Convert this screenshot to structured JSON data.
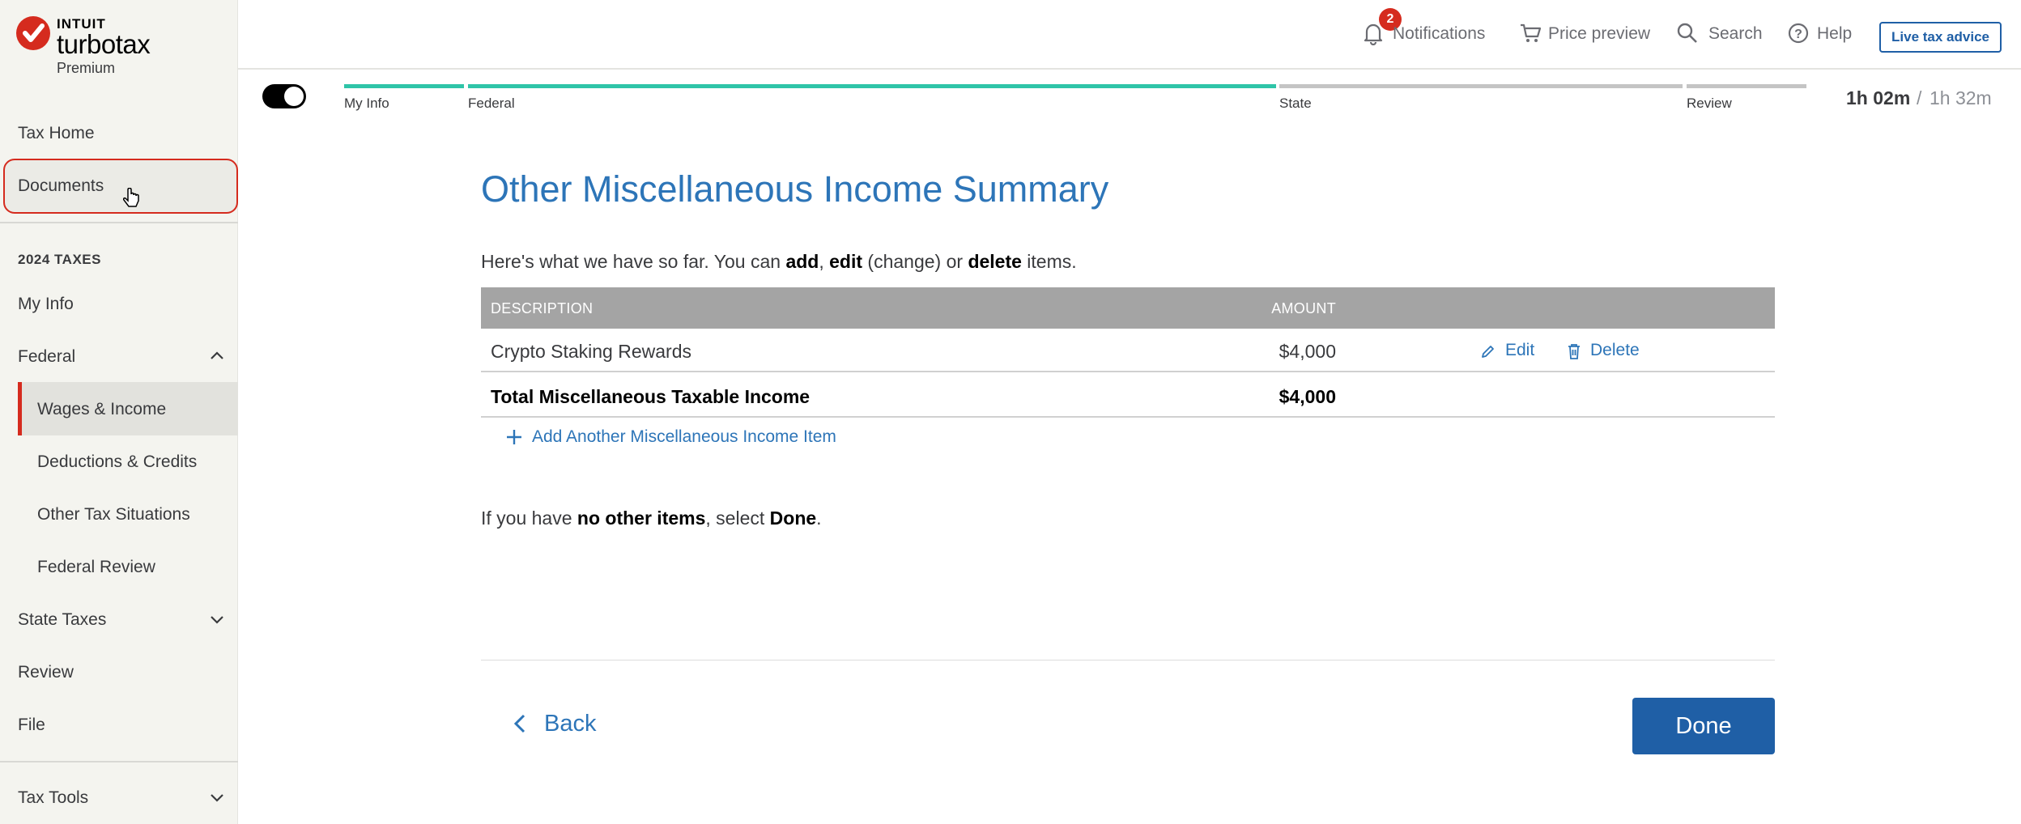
{
  "brand": {
    "company": "INTUIT",
    "product": "turbotax",
    "edition": "Premium"
  },
  "sidebar": {
    "tax_home": "Tax Home",
    "documents": "Documents",
    "section_label": "2024 TAXES",
    "my_info": "My Info",
    "federal": "Federal",
    "federal_sub": [
      "Wages & Income",
      "Deductions & Credits",
      "Other Tax Situations",
      "Federal Review"
    ],
    "state_taxes": "State Taxes",
    "review": "Review",
    "file": "File",
    "tax_tools": "Tax Tools"
  },
  "topbar": {
    "notifications": "Notifications",
    "notification_count": "2",
    "price_preview": "Price preview",
    "search": "Search",
    "help": "Help",
    "live_advice": "Live tax advice"
  },
  "progress": {
    "steps": [
      "My Info",
      "Federal",
      "State",
      "Review"
    ],
    "completed_steps": 2,
    "time_elapsed": "1h 02m",
    "time_separator": "/",
    "time_total": "1h 32m"
  },
  "main": {
    "title": "Other Miscellaneous Income Summary",
    "intro_parts": [
      "Here's what we have so far. You can ",
      "add",
      ", ",
      "edit",
      " (change) or ",
      "delete",
      " items."
    ],
    "table_headers": {
      "description": "DESCRIPTION",
      "amount": "AMOUNT"
    },
    "rows": [
      {
        "description": "Crypto Staking Rewards",
        "amount": "$4,000",
        "edit": "Edit",
        "delete": "Delete"
      }
    ],
    "total": {
      "label": "Total Miscellaneous Taxable Income",
      "amount": "$4,000"
    },
    "add_item": "Add Another Miscellaneous Income Item",
    "done_hint_parts": [
      "If you have ",
      "no other items",
      ", select ",
      "Done",
      "."
    ],
    "back": "Back",
    "done": "Done"
  },
  "colors": {
    "accent_blue": "#2d75b8",
    "button_blue": "#1f5fa6",
    "progress_done": "#2fc4a8",
    "progress_todo": "#c4c4c4",
    "brand_red": "#d52b1e"
  }
}
